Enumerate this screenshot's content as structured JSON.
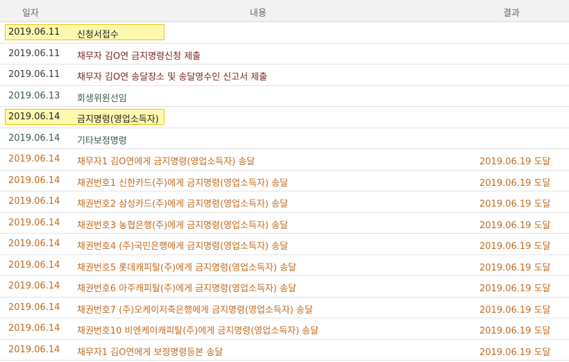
{
  "header": {
    "date": "일자",
    "content": "내용",
    "result": "결과"
  },
  "rows": [
    {
      "date": "2019.06.11",
      "content": "신청서접수",
      "result": ""
    },
    {
      "date": "2019.06.11",
      "content": "채무자 김O연 금지명령신청 제출",
      "result": ""
    },
    {
      "date": "2019.06.11",
      "content": "채무자 김O연 송달장소 및 송달영수인 신고서 제출",
      "result": ""
    },
    {
      "date": "2019.06.13",
      "content": "회생위원선임",
      "result": ""
    },
    {
      "date": "2019.06.14",
      "content": "금지명령(영업소득자)",
      "result": ""
    },
    {
      "date": "2019.06.14",
      "content": "기타보정명령",
      "result": ""
    },
    {
      "date": "2019.06.14",
      "content": "채무자1 김O연에게 금지명령(영업소득자) 송달",
      "result": "2019.06.19 도달"
    },
    {
      "date": "2019.06.14",
      "content": "채권번호1 신한카드(주)에게 금지명령(영업소득자) 송달",
      "result": "2019.06.19 도달"
    },
    {
      "date": "2019.06.14",
      "content": "채권번호2 삼성카드(주)에게 금지명령(영업소득자) 송달",
      "result": "2019.06.19 도달"
    },
    {
      "date": "2019.06.14",
      "content": "채권번호3 농협은행(주)에게 금지명령(영업소득자) 송달",
      "result": "2019.06.19 도달"
    },
    {
      "date": "2019.06.14",
      "content": "채권번호4 (주)국민은행에게 금지명령(영업소득자) 송달",
      "result": "2019.06.19 도달"
    },
    {
      "date": "2019.06.14",
      "content": "채권번호5 롯데캐피탈(주)에게 금지명령(영업소득자) 송달",
      "result": "2019.06.19 도달"
    },
    {
      "date": "2019.06.14",
      "content": "채권번호6 아주캐피탈(주)에게 금지명령(영업소득자) 송달",
      "result": "2019.06.19 도달"
    },
    {
      "date": "2019.06.14",
      "content": "채권번호7 (주)오케이저축은행에게 금지명령(영업소득자) 송달",
      "result": "2019.06.19 도달"
    },
    {
      "date": "2019.06.14",
      "content": "채권번호10 비엔케이캐피탈(주)에게 금지명령(영업소득자) 송달",
      "result": "2019.06.19 도달"
    },
    {
      "date": "2019.06.14",
      "content": "채무자1 김O연에게 보정명령등본 송달",
      "result": "2019.06.19 도달"
    }
  ],
  "colors": {
    "highlight_fill": "#fff9b0",
    "highlight_border": "#e8c400",
    "delivery_text": "#c26a1e",
    "submission_text": "#7a1f1f",
    "order_text": "#3b5a45"
  }
}
